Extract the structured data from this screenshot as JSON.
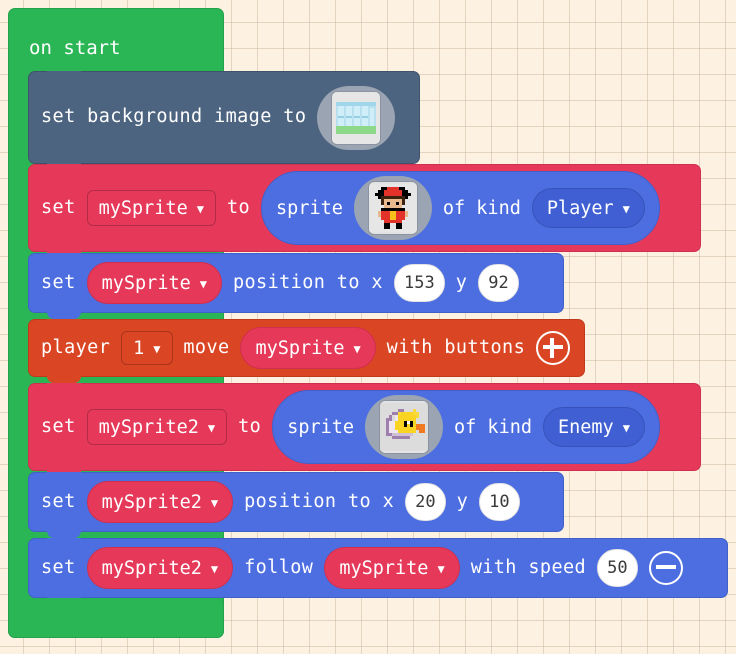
{
  "workspace": {
    "background_color": "#fdf2e1",
    "grid_color": "#e6d9c4",
    "grid_size_px": 26
  },
  "colors": {
    "event_green": "#2BB656",
    "scene_slate": "#4D6480",
    "variable_red": "#E6395A",
    "sprite_blue": "#4D6EE0",
    "controller_orange": "#DA4523"
  },
  "blocks": {
    "on_start": {
      "label": "on start",
      "category": "loops",
      "color": "#2BB656"
    },
    "set_background_image": {
      "text": "set background image to",
      "color": "#4D6480",
      "image_field": {
        "icon": "background-image-thumbnail",
        "description": "forest background with green ground and pale blue trees"
      }
    },
    "set_sprite_player": {
      "prefix": "set",
      "variable": "mySprite",
      "middle": "to",
      "reporter": {
        "text": "sprite",
        "image_field": {
          "icon": "player-sprite-thumbnail",
          "description": "pixel character with red cap and red shirt"
        },
        "of_kind_label": "of kind",
        "kind": "Player"
      },
      "color": "#E6395A"
    },
    "set_position_player": {
      "prefix": "set",
      "variable": "mySprite",
      "text": "position to x",
      "x": "153",
      "y_label": "y",
      "y": "92",
      "color": "#4D6EE0"
    },
    "player_move": {
      "prefix": "player",
      "player_number": "1",
      "verb": "move",
      "variable": "mySprite",
      "suffix": "with buttons",
      "expand_icon": "plus-circle-icon",
      "color": "#DA4523"
    },
    "set_sprite_enemy": {
      "prefix": "set",
      "variable": "mySprite2",
      "middle": "to",
      "reporter": {
        "text": "sprite",
        "image_field": {
          "icon": "duck-sprite-thumbnail",
          "description": "yellow duck hatching from a purple egg shell"
        },
        "of_kind_label": "of kind",
        "kind": "Enemy"
      },
      "color": "#E6395A"
    },
    "set_position_enemy": {
      "prefix": "set",
      "variable": "mySprite2",
      "text": "position to x",
      "x": "20",
      "y_label": "y",
      "y": "10",
      "color": "#4D6EE0"
    },
    "set_follow": {
      "prefix": "set",
      "variable": "mySprite2",
      "verb": "follow",
      "target": "mySprite",
      "suffix": "with speed",
      "speed": "50",
      "collapse_icon": "minus-circle-icon",
      "color": "#4D6EE0"
    }
  },
  "dropdown_caret": "▼"
}
